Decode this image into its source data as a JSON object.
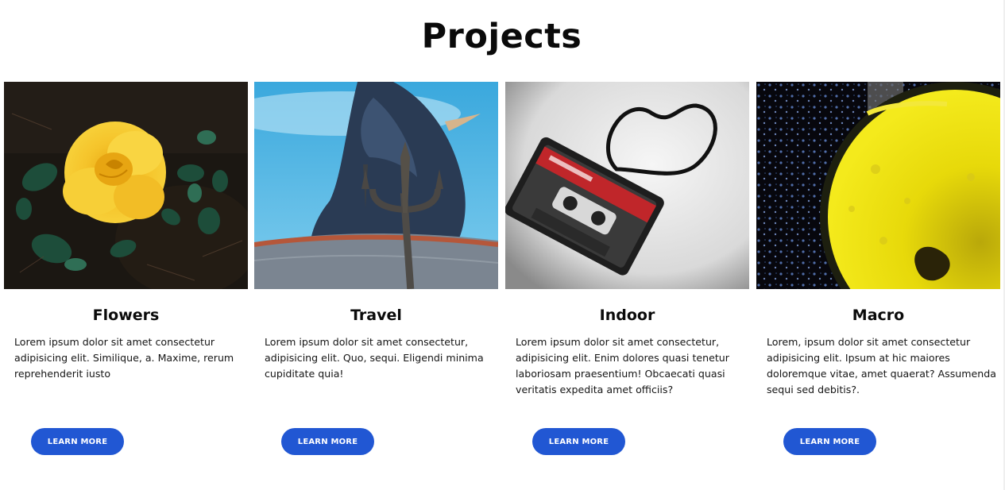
{
  "section": {
    "title": "Projects"
  },
  "theme": {
    "button_color": "#2157d3",
    "button_text_color": "#ffffff",
    "background": "#ffffff"
  },
  "projects": [
    {
      "title": "Flowers",
      "text": "Lorem ipsum dolor sit amet consectetur adipisicing elit. Similique, a. Maxime, rerum reprehenderit iusto",
      "button": "LEARN MORE",
      "image": "yellow-rose-photo"
    },
    {
      "title": "Travel",
      "text": "Lorem ipsum dolor sit amet consectetur, adipisicing elit. Quo, sequi. Eligendi minima cupiditate quia!",
      "button": "LEARN MORE",
      "image": "statue-trident-photo"
    },
    {
      "title": "Indoor",
      "text": "Lorem ipsum dolor sit amet consectetur, adipisicing elit. Enim dolores quasi tenetur laboriosam praesentium! Obcaecati quasi veritatis expedita amet officiis?",
      "button": "LEARN MORE",
      "image": "cassette-tape-heart-photo"
    },
    {
      "title": "Macro",
      "text": "Lorem, ipsum dolor sit amet consectetur adipisicing elit. Ipsum at hic maiores doloremque vitae, amet quaerat? Assumenda sequi sed debitis?.",
      "button": "LEARN MORE",
      "image": "lemon-slice-photo"
    }
  ]
}
